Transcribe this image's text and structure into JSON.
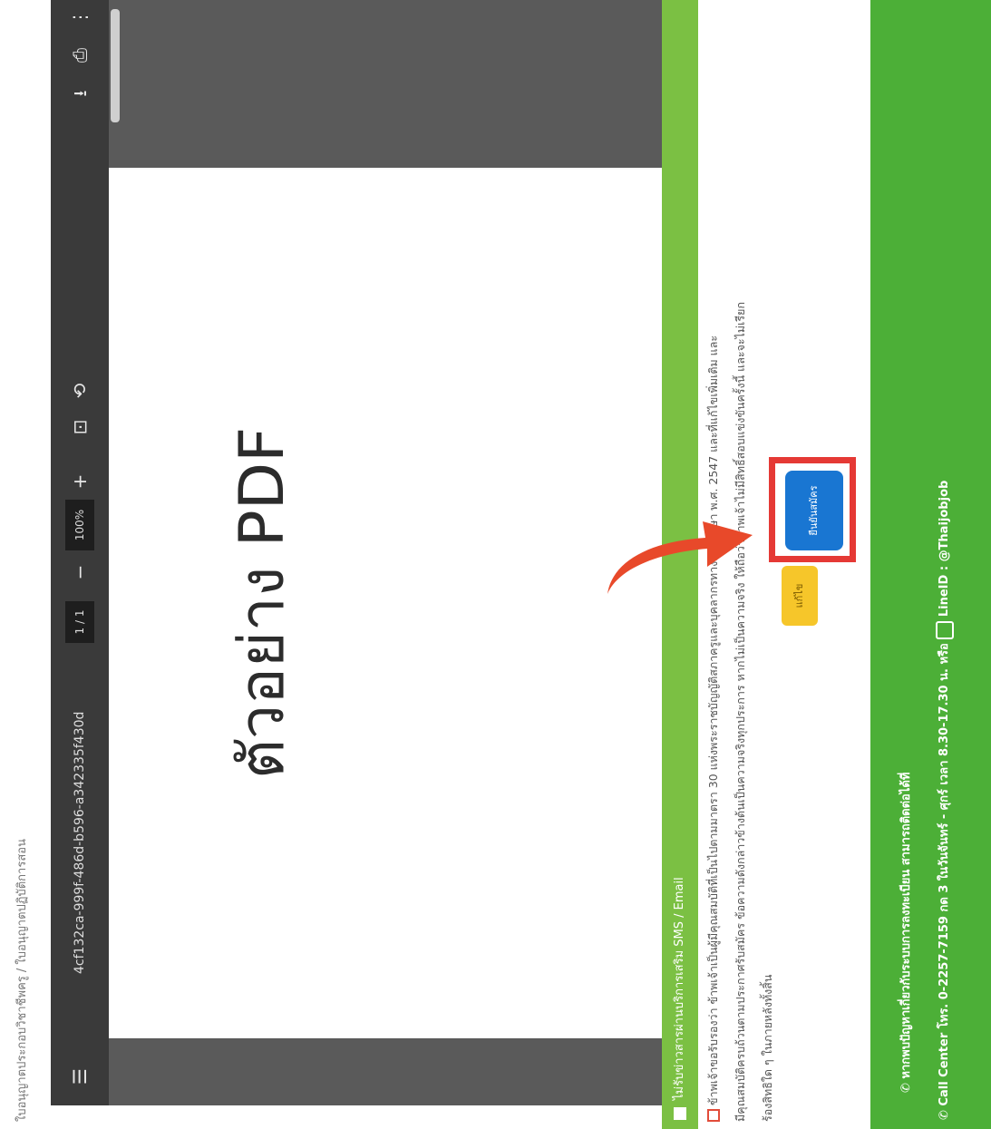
{
  "breadcrumb": "ใบอนุญาตประกอบวิชาชีพครู / ใบอนุญาตปฏิบัติการสอน",
  "viewer": {
    "file_name": "4cf132ca-999f-486d-b596-a342335f430d",
    "page_indicator": "1 / 1",
    "zoom": "100%",
    "zoom_out": "−",
    "zoom_in": "+",
    "menu_icon": "hamburger-icon",
    "download_icon": "download-icon",
    "print_icon": "print-icon",
    "more_icon": "more-vertical-icon"
  },
  "pdf_placeholder": "ตัวอย่าง PDF",
  "notice_bar": {
    "label": "ไม่รับข่าวสารผ่านบริการเสริม SMS / Email"
  },
  "consent": {
    "line1": "ข้าพเจ้าขอรับรองว่า ข้าพเจ้าเป็นผู้มีคุณสมบัติที่เป็นไปตามมาตรา 30 แห่งพระราชบัญญัติสภาครูและบุคลากรทางการศึกษา พ.ศ. 2547 และที่แก้ไขเพิ่มเติม และ",
    "line2": "มีคุณสมบัติครบถ้วนตามประกาศรับสมัคร ข้อความดังกล่าวข้างต้นเป็นความจริงทุกประการ หากไม่เป็นความจริง ให้ถือว่าข้าพเจ้าไม่มีสิทธิ์สอบแข่งขันครั้งนี้ และจะไม่เรียก",
    "line3": "ร้องสิทธิใด ๆ ในภายหลังทั้งสิ้น"
  },
  "buttons": {
    "back": "แก้ไข",
    "confirm": "ยืนยันสมัคร"
  },
  "footer": {
    "line1": "หากพบปัญหาเกี่ยวกับระบบการลงทะเบียน สามารถติดต่อได้ที่",
    "line2": "Call Center โทร. 0-2257-7159 กด 3 ในวันจันทร์ - ศุกร์ เวลา 8.30-17.30 น. หรือ",
    "line_label": "LineID : @Thaijobjob"
  },
  "colors": {
    "toolbar": "#3a3a3a",
    "green": "#4caf37",
    "highlight": "#e53935",
    "confirm_button": "#1976d2",
    "back_button": "#f6c62a"
  }
}
